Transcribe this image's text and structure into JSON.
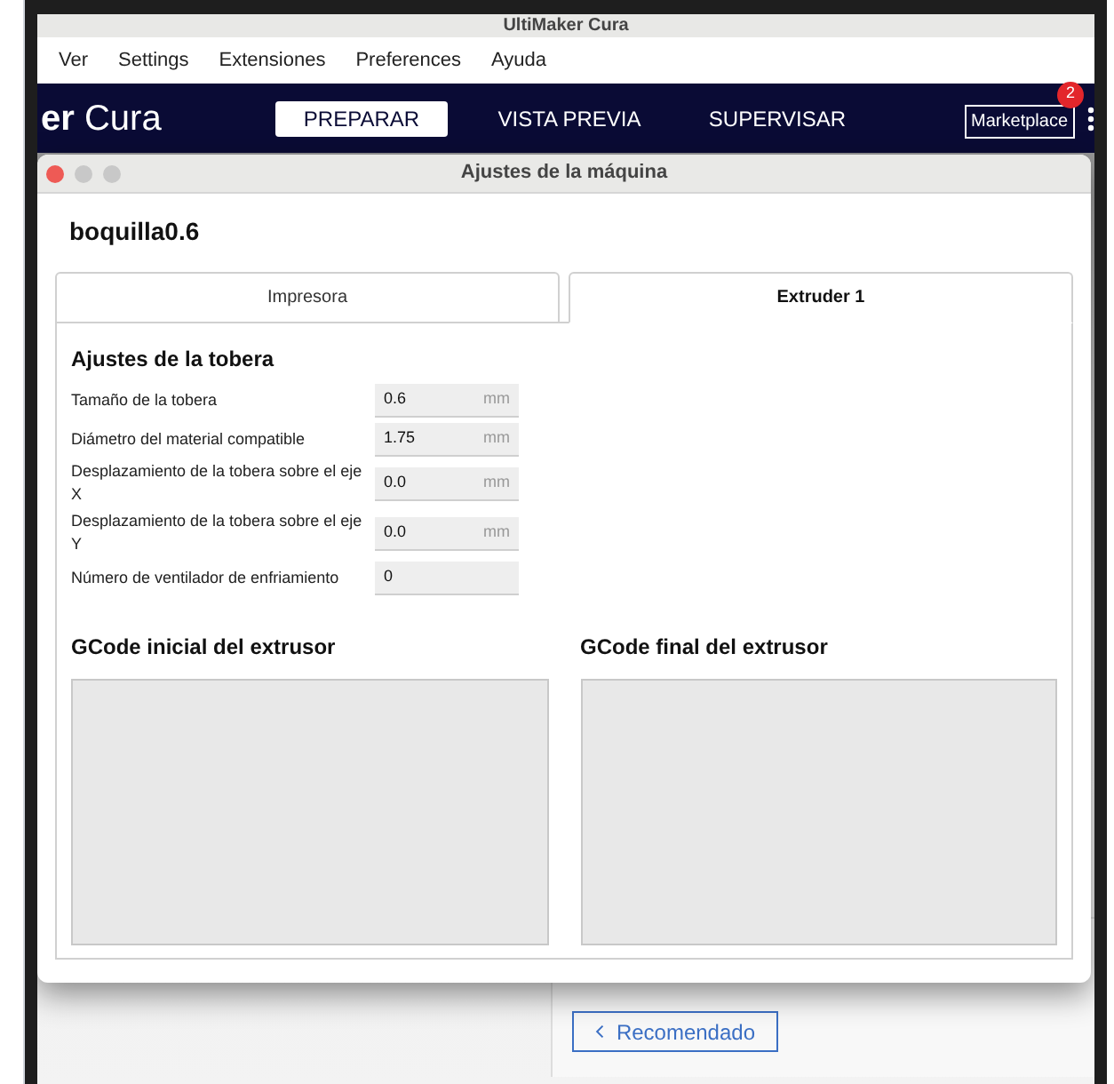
{
  "app_title": "UltiMaker Cura",
  "menu": [
    "Ver",
    "Settings",
    "Extensiones",
    "Preferences",
    "Ayuda"
  ],
  "logo": "**er** Cura",
  "stages": [
    {
      "label": "PREPARAR",
      "selected": true
    },
    {
      "label": "VISTA PREVIA",
      "selected": false
    },
    {
      "label": "SUPERVISAR",
      "selected": false
    }
  ],
  "marketplace": {
    "label": "Marketplace",
    "badge": "2"
  },
  "dialog": {
    "title": "Ajustes de la máquina",
    "machine": "boquilla0.6",
    "tabs": [
      {
        "label": "Impresora",
        "selected": false
      },
      {
        "label": "Extruder 1",
        "selected": true
      }
    ],
    "section_title": "Ajustes de la tobera",
    "fields": [
      {
        "label": "Tamaño de la tobera",
        "value": "0.6",
        "unit": "mm"
      },
      {
        "label": "Diámetro del material compatible",
        "value": "1.75",
        "unit": "mm"
      },
      {
        "label": "Desplazamiento de la tobera sobre el eje X",
        "value": "0.0",
        "unit": "mm"
      },
      {
        "label": "Desplazamiento de la tobera sobre el eje Y",
        "value": "0.0",
        "unit": "mm"
      },
      {
        "label": "Número de ventilador de enfriamiento",
        "value": "0"
      }
    ],
    "gcode": [
      {
        "title": "GCode inicial del extrusor"
      },
      {
        "title": "GCode final del extrusor"
      }
    ]
  },
  "back_button": "Recomendado"
}
